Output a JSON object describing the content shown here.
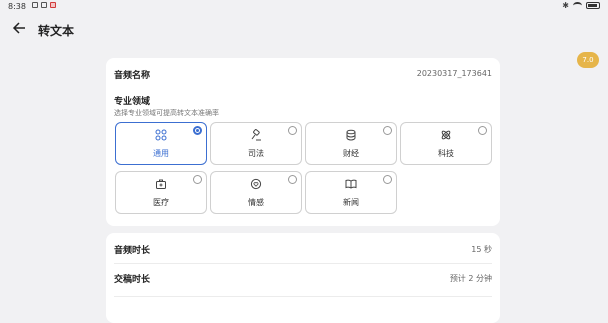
{
  "status_bar": {
    "time": "8:38"
  },
  "header": {
    "title": "转文本"
  },
  "version_badge": "7.0",
  "audio": {
    "name_label": "音频名称",
    "name_value": "20230317_173641"
  },
  "domain": {
    "title": "专业领域",
    "subtitle": "选择专业领域可提高转文本准确率",
    "selected": "通用",
    "options": [
      {
        "label": "通用",
        "icon": "grid-icon"
      },
      {
        "label": "司法",
        "icon": "gavel-icon"
      },
      {
        "label": "财经",
        "icon": "coins-icon"
      },
      {
        "label": "科技",
        "icon": "atom-icon"
      },
      {
        "label": "医疗",
        "icon": "medical-kit-icon"
      },
      {
        "label": "情感",
        "icon": "heart-chat-icon"
      },
      {
        "label": "新闻",
        "icon": "book-icon"
      }
    ]
  },
  "details": {
    "duration_label": "音频时长",
    "duration_value": "15 秒",
    "submit_label": "交稿时长",
    "submit_value": "预计 2 分钟"
  },
  "colors": {
    "accent": "#3c6fd1",
    "badge": "#e6b54a"
  }
}
